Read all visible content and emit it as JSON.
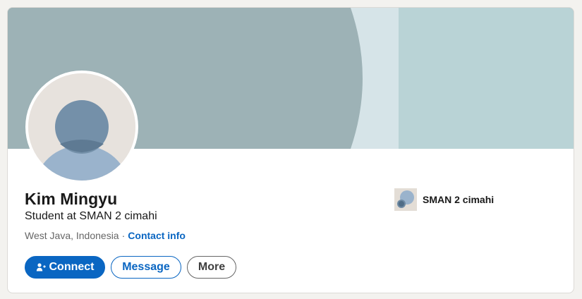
{
  "profile": {
    "name": "Kim Mingyu",
    "headline": "Student at SMAN 2 cimahi",
    "location": "West Java, Indonesia",
    "separator": "·",
    "contact_info_label": "Contact info"
  },
  "actions": {
    "connect_label": "Connect",
    "message_label": "Message",
    "more_label": "More"
  },
  "education": {
    "school_name": "SMAN 2 cimahi"
  },
  "icons": {
    "connect": "add-person-icon",
    "school_logo": "school-logo-placeholder-icon",
    "avatar": "default-avatar-icon"
  },
  "colors": {
    "brand_blue": "#0a66c2",
    "cover_base": "#9db2b6",
    "cover_light": "#d6e4e8",
    "cover_right": "#b9d3d6",
    "avatar_bg": "#e7e2dd",
    "avatar_head": "#7490a9",
    "avatar_body": "#9ab3cc"
  }
}
